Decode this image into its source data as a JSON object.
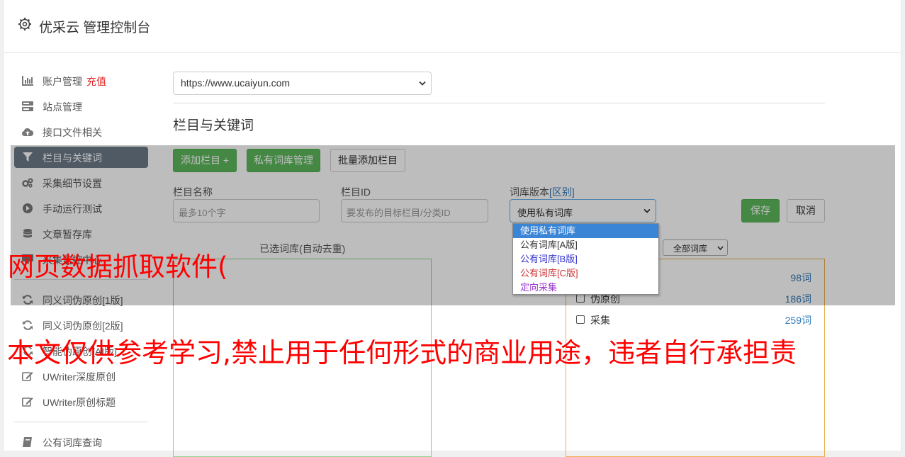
{
  "header": {
    "title": "优采云 管理控制台"
  },
  "sidebar": {
    "items": [
      {
        "label": "账户管理",
        "badge": "充值",
        "icon": "bar-chart-icon"
      },
      {
        "label": "站点管理",
        "icon": "server-icon"
      },
      {
        "label": "接口文件相关",
        "icon": "cloud-upload-icon"
      },
      {
        "label": "栏目与关键词",
        "icon": "filter-icon",
        "active": true
      },
      {
        "label": "采集细节设置",
        "icon": "gears-icon"
      },
      {
        "label": "手动运行测试",
        "icon": "play-circle-icon"
      },
      {
        "label": "文章暂存库",
        "icon": "database-icon"
      },
      {
        "label": "采集监控中心",
        "icon": "monitor-icon"
      },
      {
        "label": "同义词伪原创[1版]",
        "icon": "refresh-icon"
      },
      {
        "label": "同义词伪原创[2版]",
        "icon": "refresh-icon"
      },
      {
        "label": "智能伪原创[AI版]",
        "icon": "refresh-icon"
      },
      {
        "label": "UWriter深度原创",
        "icon": "edit-icon"
      },
      {
        "label": "UWriter原创标题",
        "icon": "edit-icon"
      },
      {
        "label": "公有词库查询",
        "icon": "book-icon"
      }
    ]
  },
  "main": {
    "site_select": "https://www.ucaiyun.com",
    "section_title": "栏目与关键词",
    "buttons": {
      "add_column": "添加栏目 +",
      "private_lib": "私有词库管理",
      "batch_add": "批量添加栏目",
      "save": "保存",
      "cancel": "取消"
    },
    "form": {
      "name_label": "栏目名称",
      "name_placeholder": "最多10个字",
      "id_label": "栏目ID",
      "id_placeholder": "要发布的目标栏目/分类ID",
      "lib_label": "词库版本",
      "lib_diff": "[区别]",
      "lib_value": "使用私有词库"
    },
    "dropdown_options": [
      {
        "label": "使用私有词库",
        "color": "#ffffff"
      },
      {
        "label": "公有词库[A版]",
        "color": "#333333"
      },
      {
        "label": "公有词库[B版]",
        "color": "#3333cc"
      },
      {
        "label": "公有词库[C版]",
        "color": "#cc3333"
      },
      {
        "label": "定向采集",
        "color": "#9933cc"
      }
    ],
    "selected_libs_label": "已选词库(自动去重)",
    "all_libs_select": "全部词库",
    "libraries": [
      {
        "name": "",
        "count": "98词"
      },
      {
        "name": "伪原创",
        "count": "186词"
      },
      {
        "name": "采集",
        "count": "259词"
      }
    ]
  },
  "watermark": {
    "line1": "网页数据抓取软件(",
    "line2": "本文仅供参考学习,禁止用于任何形式的商业用途，违者自行承担责"
  },
  "colors": {
    "accent_green": "#5cb85c",
    "active_nav": "#6c7a89",
    "link_blue": "#337ab7",
    "watermark_red": "#ff0000"
  }
}
